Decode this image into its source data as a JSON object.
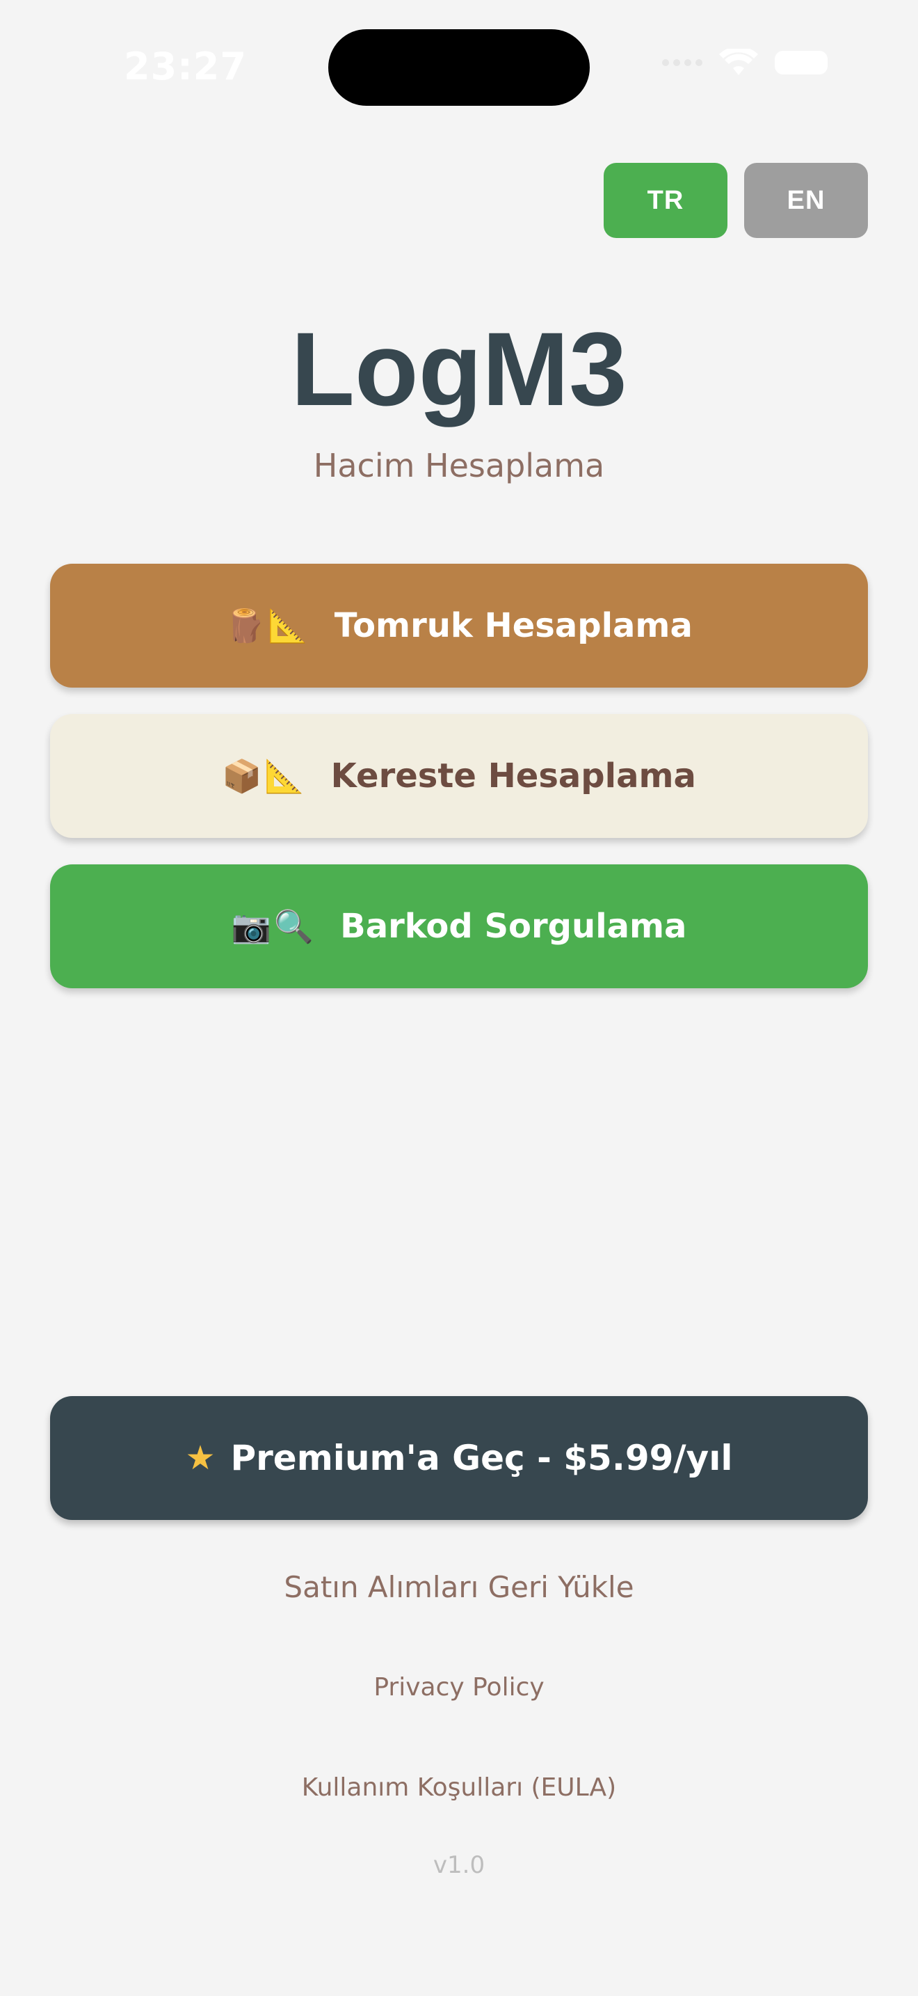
{
  "status_bar": {
    "time": "23:27"
  },
  "language": {
    "options": [
      {
        "label": "TR",
        "active": true
      },
      {
        "label": "EN",
        "active": false
      }
    ],
    "active_color": "#4caf50",
    "inactive_color": "#9e9e9e"
  },
  "header": {
    "title": "LogM3",
    "subtitle": "Hacim Hesaplama"
  },
  "actions": {
    "log": {
      "icon": "🪵📐",
      "label": "Tomruk Hesaplama",
      "color": "#b98147"
    },
    "lumber": {
      "icon": "📦📐",
      "label": "Kereste Hesaplama",
      "color": "#f2eee0"
    },
    "barcode": {
      "icon": "📷🔍",
      "label": "Barkod Sorgulama",
      "color": "#4caf50"
    }
  },
  "premium": {
    "icon": "★",
    "label": "Premium'a Geç - $5.99/yıl",
    "color": "#37474f"
  },
  "links": {
    "restore": "Satın Alımları Geri Yükle",
    "privacy": "Privacy Policy",
    "eula": "Kullanım Koşulları (EULA)"
  },
  "version": "v1.0"
}
